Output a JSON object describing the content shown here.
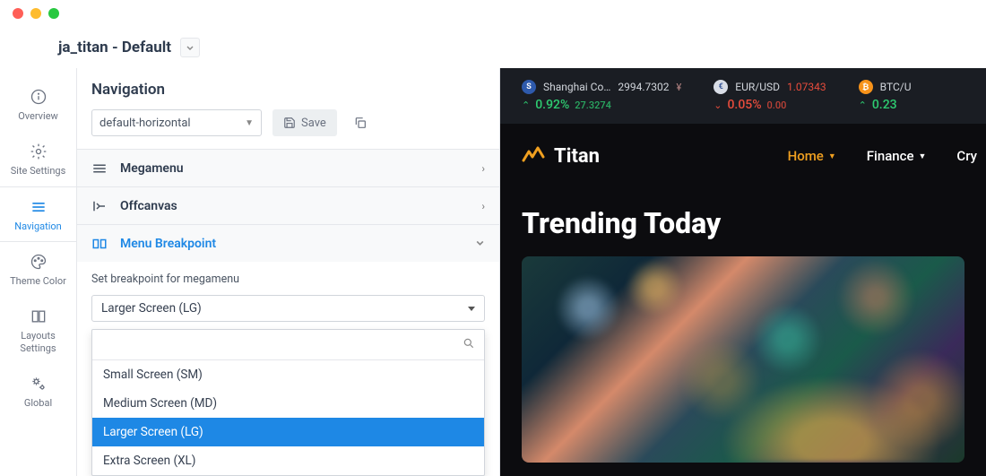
{
  "header": {
    "title": "ja_titan - Default"
  },
  "sidebar": {
    "items": [
      {
        "label": "Overview"
      },
      {
        "label": "Site Settings"
      },
      {
        "label": "Navigation"
      },
      {
        "label": "Theme Color"
      },
      {
        "label": "Layouts Settings"
      },
      {
        "label": "Global"
      }
    ]
  },
  "panel": {
    "title": "Navigation",
    "nav_select": "default-horizontal",
    "save_label": "Save",
    "accordion": {
      "megamenu": "Megamenu",
      "offcanvas": "Offcanvas",
      "breakpoint": "Menu Breakpoint"
    },
    "breakpoint_desc": "Set breakpoint for megamenu",
    "breakpoint_value": "Larger Screen (LG)",
    "breakpoint_options": [
      "Small Screen (SM)",
      "Medium Screen (MD)",
      "Larger Screen (LG)",
      "Extra Screen (XL)"
    ],
    "search_value": ""
  },
  "preview": {
    "ticker": [
      {
        "name": "Shanghai Co…",
        "value": "2994.7302",
        "cur": "¥",
        "pct": "0.92%",
        "sub": "27.3274",
        "dir": "up",
        "color": "green",
        "sym_bg": "#2e5aac",
        "sym_txt": "S"
      },
      {
        "name": "EUR/USD",
        "value": "1.07343",
        "cur": "",
        "pct": "0.05%",
        "sub": "0.00",
        "dir": "down",
        "color": "red",
        "sym_bg": "#3b5998",
        "sym_txt": "€"
      },
      {
        "name": "BTC/U",
        "value": "",
        "cur": "",
        "pct": "0.23",
        "sub": "",
        "dir": "up",
        "color": "green",
        "sym_bg": "#f7931a",
        "sym_txt": "₿"
      }
    ],
    "logo": "Titan",
    "nav": [
      {
        "label": "Home",
        "active": true,
        "dd": true
      },
      {
        "label": "Finance",
        "active": false,
        "dd": true
      },
      {
        "label": "Cry",
        "active": false,
        "dd": false
      }
    ],
    "hero": "Trending Today"
  }
}
